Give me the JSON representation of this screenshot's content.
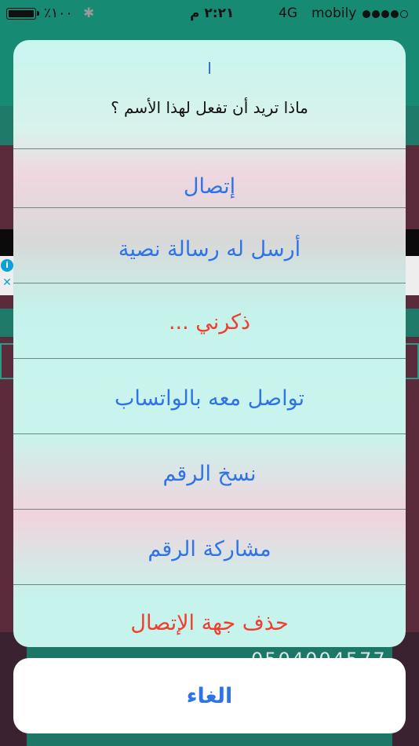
{
  "status_bar": {
    "carrier": "mobily",
    "network": "4G",
    "time": "٢:٢١ م",
    "battery_text": "٪١٠٠",
    "signal_bars_filled": 4,
    "signal_bars_total": 5
  },
  "background": {
    "phone_number_partial": "0504004577"
  },
  "action_sheet": {
    "title": "ا",
    "message": "ماذا تريد أن تفعل لهذا الأسم ؟",
    "actions": [
      {
        "label": "إتصال",
        "style": "default"
      },
      {
        "label": "أرسل له رسالة نصية",
        "style": "default"
      },
      {
        "label": "ذكرني ...",
        "style": "destructive"
      },
      {
        "label": "تواصل معه بالواتساب",
        "style": "default"
      },
      {
        "label": "نسخ الرقم",
        "style": "default"
      },
      {
        "label": "مشاركة الرقم",
        "style": "default"
      },
      {
        "label": "حذف جهة الإتصال",
        "style": "destructive"
      }
    ],
    "cancel_label": "الغاء"
  },
  "colors": {
    "action_blue": "#2f73e8",
    "destructive_red": "#f23c2d",
    "app_green": "#178a73",
    "app_maroon": "#5a2b3b"
  }
}
